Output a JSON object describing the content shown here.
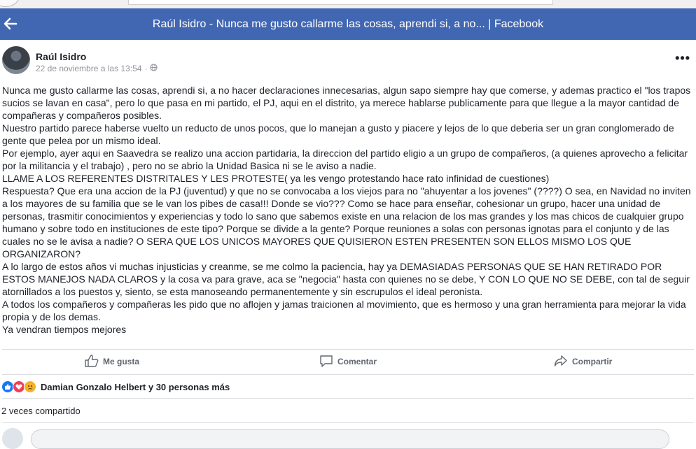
{
  "header": {
    "title": "Raúl Isidro - Nunca me gusto callarme las cosas, aprendi si, a no... | Facebook"
  },
  "post": {
    "author": "Raúl Isidro",
    "timestamp": "22 de noviembre a las 13:54",
    "separator": "·",
    "paragraphs": [
      "Nunca me gusto callarme las cosas, aprendi si, a no hacer declaraciones innecesarias, algun sapo siempre hay que comerse, y ademas practico el \"los trapos sucios se lavan en casa\", pero lo que pasa en mi partido, el PJ, aqui en el distrito, ya merece hablarse publicamente para que llegue a la mayor cantidad de compañeras y compañeros posibles.",
      "Nuestro partido parece haberse vuelto un reducto de unos pocos, que lo manejan a gusto y piacere y lejos de lo que deberia ser un gran conglomerado de gente que pelea por un mismo ideal.",
      "Por ejemplo, ayer aqui en Saavedra se realizo una accion partidaria, la direccion del partido eligio a un grupo de compañeros, (a quienes aprovecho a felicitar por la militancia y el trabajo) , pero no se abrio la Unidad Basica ni se le aviso a nadie.",
      "LLAME A LOS REFERENTES DISTRITALES Y LES PROTESTE( ya les vengo protestando hace rato infinidad de cuestiones)",
      "Respuesta? Que era una accion de la PJ (juventud) y que no se convocaba a los viejos para no \"ahuyentar a los jovenes\" (????) O sea, en Navidad no inviten a los mayores de su familia que se le van los pibes de casa!!! Donde se vio??? Como se hace para enseñar, cohesionar un grupo, hacer una unidad de personas, trasmitir conocimientos y experiencias y todo lo sano que sabemos existe en una relacion de los mas grandes y los mas chicos de cualquier grupo humano y sobre todo en instituciones de este tipo? Porque se divide a la gente? Porque reuniones a solas con personas ignotas para el conjunto y de las cuales no se le avisa a nadie? O SERA QUE LOS UNICOS MAYORES QUE QUISIERON ESTEN PRESENTEN SON ELLOS MISMO LOS QUE ORGANIZARON?",
      "A lo largo de estos años vi muchas injusticias y creanme, se me colmo la paciencia, hay ya DEMASIADAS PERSONAS QUE SE HAN RETIRADO POR ESTOS MANEJOS NADA CLAROS y la cosa va para grave, aca se \"negocia\" hasta con quienes no se debe, Y CON LO QUE NO SE DEBE, con tal de seguir atornillados a los puestos y, siento, se esta manoseando permanentemente y sin escrupulos el ideal peronista.",
      "A todos los compañeros y compañeras les pido que no aflojen y jamas traicionen al movimiento, que es hermoso y una gran herramienta para mejorar la vida propia y de los demas.",
      "Ya vendran tiempos mejores"
    ]
  },
  "actions": {
    "like": "Me gusta",
    "comment": "Comentar",
    "share": "Compartir"
  },
  "reactions": {
    "icons": [
      "like-reaction-icon",
      "love-reaction-icon",
      "sad-reaction-icon"
    ],
    "summary": "Damian Gonzalo Helbert y 30 personas más"
  },
  "shares": "2 veces compartido",
  "colors": {
    "header": "#4267b2",
    "like": "#1877f2",
    "love": "#f33e58",
    "sad": "#f7b125",
    "muted": "#606770"
  }
}
